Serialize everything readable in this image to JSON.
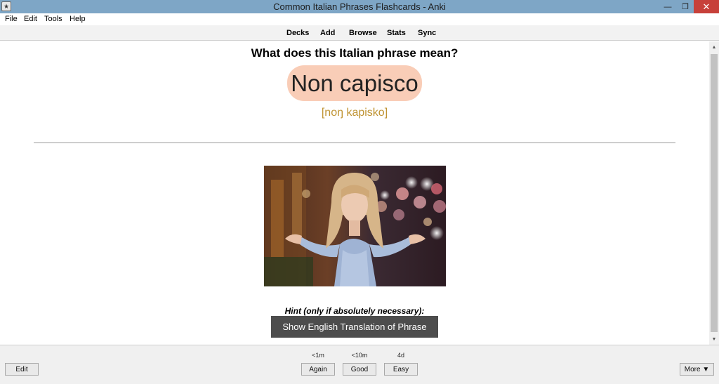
{
  "window": {
    "title": "Common Italian Phrases Flashcards - Anki",
    "minimize_glyph": "—",
    "maximize_glyph": "❐",
    "close_glyph": "✕"
  },
  "menu": [
    "File",
    "Edit",
    "Tools",
    "Help"
  ],
  "toolbar": [
    "Decks",
    "Add",
    "Browse",
    "Stats",
    "Sync"
  ],
  "card": {
    "question": "What does this Italian phrase mean?",
    "phrase": "Non capisco",
    "pronunciation": "[noŋ kapisko]",
    "hint_label": "Hint (only if absolutely necessary):",
    "hint_button": "Show English Translation of Phrase"
  },
  "answer_buttons": [
    {
      "label": "Again",
      "interval": "<1m"
    },
    {
      "label": "Good",
      "interval": "<10m"
    },
    {
      "label": "Easy",
      "interval": "4d"
    }
  ],
  "bottom": {
    "edit_label": "Edit",
    "more_label": "More ▼"
  },
  "colors": {
    "titlebar": "#7ea6c6",
    "phrase_bg": "#f9cdb7",
    "pronunciation": "#bf9332",
    "hint_button_bg": "#4d4d4d",
    "close_button": "#c7403a"
  }
}
